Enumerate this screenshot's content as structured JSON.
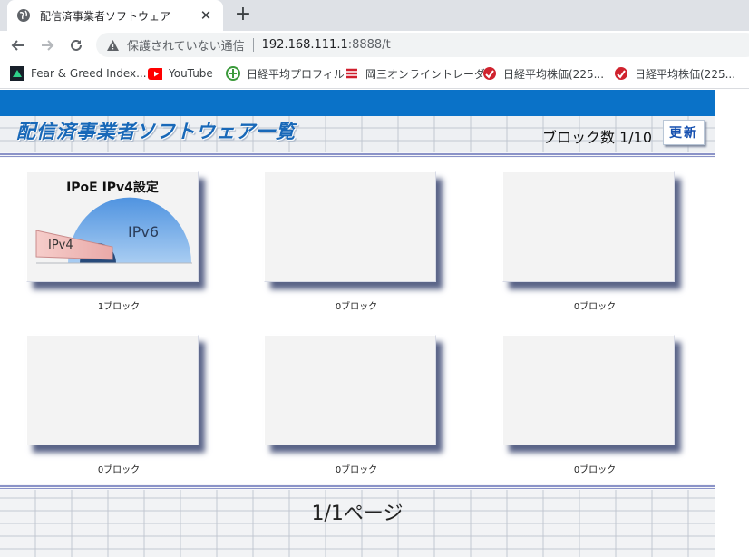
{
  "browser": {
    "tab": {
      "title": "配信済事業者ソフトウェア",
      "close_glyph": "✕"
    },
    "new_tab_glyph": "+",
    "omnibox": {
      "security_label": "保護されていない通信",
      "url_host": "192.168.111.1",
      "url_path": ":8888/t"
    },
    "bookmarks": [
      {
        "label": "Fear & Greed Index...",
        "icon": "fear-greed-icon"
      },
      {
        "label": "YouTube",
        "icon": "youtube-icon"
      },
      {
        "label": "日経平均プロフィル",
        "icon": "nikkei-profile-icon"
      },
      {
        "label": "岡三オンライントレーダ...",
        "icon": "okasan-icon"
      },
      {
        "label": "日経平均株価(225...",
        "icon": "nikkei-stock-icon"
      },
      {
        "label": "日経平均株価(225...",
        "icon": "nikkei-stock-icon"
      }
    ]
  },
  "page": {
    "title": "配信済事業者ソフトウェア一覧",
    "block_count": "ブロック数 1/10",
    "refresh_label": "更新",
    "tiles": [
      {
        "title": "IPoE IPv4設定",
        "caption": "1ブロック",
        "ipv6_label": "IPv6",
        "ipv4_label": "IPv4"
      },
      {
        "title": "",
        "caption": "0ブロック"
      },
      {
        "title": "",
        "caption": "0ブロック"
      },
      {
        "title": "",
        "caption": "0ブロック"
      },
      {
        "title": "",
        "caption": "0ブロック"
      },
      {
        "title": "",
        "caption": "0ブロック"
      }
    ],
    "pager": "1/1ページ"
  },
  "colors": {
    "header_blue": "#0a72c8",
    "title_blue": "#1868b8",
    "divider": "#8b93c8",
    "ipv6_dome": "#7fb3ea",
    "ipv4_pipe": "#eec0bf"
  }
}
